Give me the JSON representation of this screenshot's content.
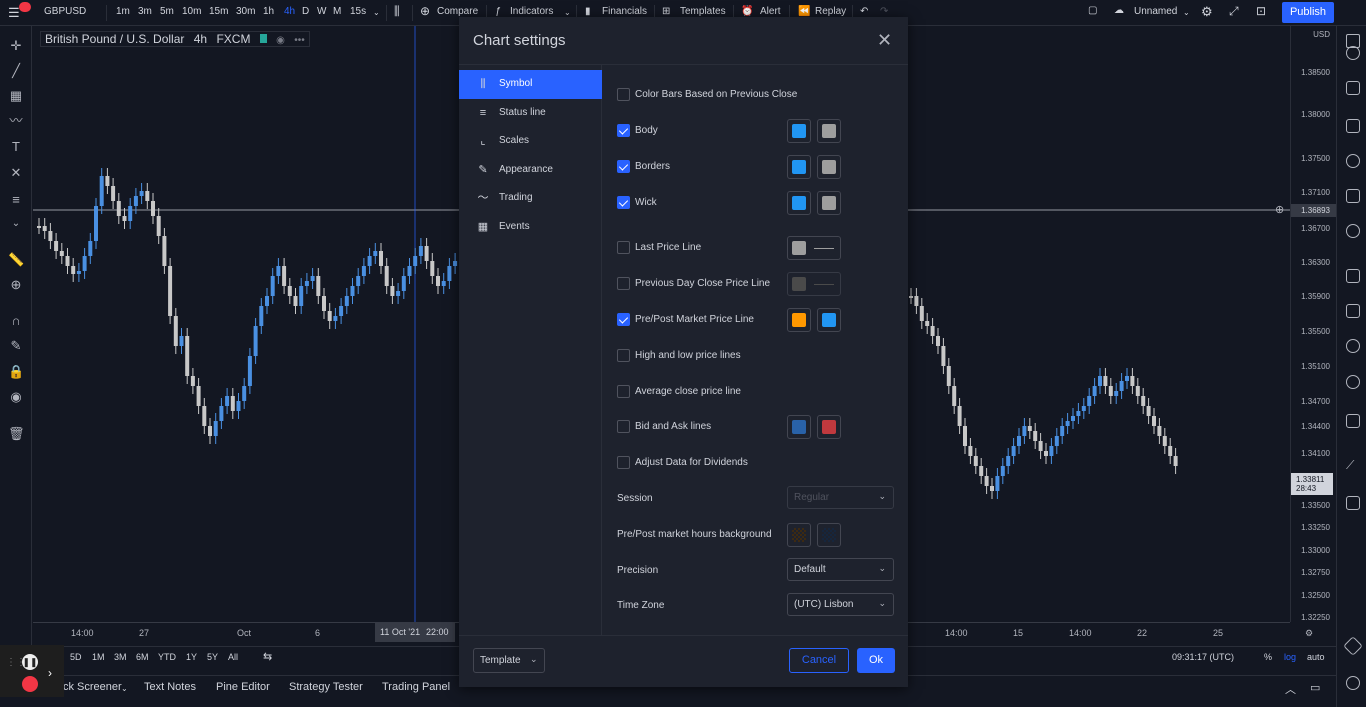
{
  "topbar": {
    "symbol": "GBPUSD",
    "intervals": [
      "1m",
      "3m",
      "5m",
      "10m",
      "15m",
      "30m",
      "1h",
      "4h",
      "D",
      "W",
      "M",
      "15s"
    ],
    "active_interval": "4h",
    "compare": "Compare",
    "indicators": "Indicators",
    "financials": "Financials",
    "templates": "Templates",
    "alert": "Alert",
    "replay": "Replay",
    "layout_name": "Unnamed",
    "publish": "Publish"
  },
  "legend": {
    "title": "British Pound / U.S. Dollar",
    "interval": "4h",
    "exchange": "FXCM"
  },
  "price_scale": {
    "currency": "USD",
    "ticks": [
      "1.38500",
      "1.38000",
      "1.37500",
      "1.37100",
      "1.36700",
      "1.36300",
      "1.35900",
      "1.35500",
      "1.35100",
      "1.34700",
      "1.34400",
      "1.34100",
      "1.33500",
      "1.33250",
      "1.33000",
      "1.32750",
      "1.32500",
      "1.32250"
    ],
    "crosshair_price": "1.36893",
    "last_price": "1.33811",
    "countdown": "28:43"
  },
  "time_axis": {
    "ticks": [
      "14:00",
      "27",
      "Oct",
      "6",
      "14:00",
      "15",
      "14:00",
      "22",
      "25"
    ],
    "crosshair_label": "11 Oct '21",
    "crosshair_time": "22:00"
  },
  "range_bar": {
    "ranges": [
      "5D",
      "1M",
      "3M",
      "6M",
      "YTD",
      "1Y",
      "5Y",
      "All"
    ],
    "clock": "09:31:17 (UTC)",
    "percent": "%",
    "log": "log",
    "auto": "auto"
  },
  "bottom_tabs": [
    "ck Screener",
    "Text Notes",
    "Pine Editor",
    "Strategy Tester",
    "Trading Panel"
  ],
  "modal": {
    "title": "Chart settings",
    "nav": [
      {
        "label": "Symbol",
        "icon": "candles-icon",
        "active": true
      },
      {
        "label": "Status line",
        "icon": "lines-icon",
        "active": false
      },
      {
        "label": "Scales",
        "icon": "scales-icon",
        "active": false
      },
      {
        "label": "Appearance",
        "icon": "brush-icon",
        "active": false
      },
      {
        "label": "Trading",
        "icon": "trading-icon",
        "active": false
      },
      {
        "label": "Events",
        "icon": "calendar-icon",
        "active": false
      }
    ],
    "options": {
      "color_bars": {
        "label": "Color Bars Based on Previous Close",
        "checked": false
      },
      "body": {
        "label": "Body",
        "checked": true,
        "up_color": "#2196f3",
        "down_color": "#9e9e9e"
      },
      "borders": {
        "label": "Borders",
        "checked": true,
        "up_color": "#2196f3",
        "down_color": "#9e9e9e"
      },
      "wick": {
        "label": "Wick",
        "checked": true,
        "up_color": "#2196f3",
        "down_color": "#9e9e9e"
      },
      "last_price_line": {
        "label": "Last Price Line",
        "checked": false,
        "color": "#9e9e9e"
      },
      "prev_day_close": {
        "label": "Previous Day Close Price Line",
        "checked": false,
        "color": "#4a4a4a"
      },
      "pre_post_line": {
        "label": "Pre/Post Market Price Line",
        "checked": true,
        "pre_color": "#ff9800",
        "post_color": "#2196f3"
      },
      "high_low": {
        "label": "High and low price lines",
        "checked": false
      },
      "avg_close": {
        "label": "Average close price line",
        "checked": false
      },
      "bid_ask": {
        "label": "Bid and Ask lines",
        "checked": false,
        "bid_color": "#2962a8",
        "ask_color": "#c0393e"
      },
      "dividends": {
        "label": "Adjust Data for Dividends",
        "checked": false
      }
    },
    "session": {
      "label": "Session",
      "value": "Regular"
    },
    "pre_post_bg": {
      "label": "Pre/Post market hours background"
    },
    "precision": {
      "label": "Precision",
      "value": "Default"
    },
    "timezone": {
      "label": "Time Zone",
      "value": "(UTC) Lisbon"
    },
    "footer": {
      "template": "Template",
      "cancel": "Cancel",
      "ok": "Ok"
    }
  },
  "colors": {
    "accent": "#2962ff",
    "bull": "#4a90e2",
    "bear": "#c8c8c8"
  }
}
